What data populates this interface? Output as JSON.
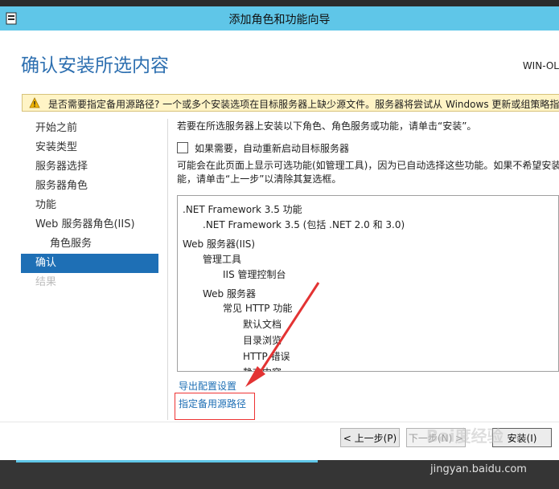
{
  "window": {
    "title": "添加角色和功能向导"
  },
  "header": {
    "page_title": "确认安装所选内容",
    "server_name": "WIN-OL"
  },
  "warning": {
    "text": "是否需要指定备用源路径? 一个或多个安装选项在目标服务器上缺少源文件。服务器将尝试从 Windows 更新或组策略指"
  },
  "nav": {
    "items": [
      {
        "label": "开始之前",
        "state": "normal"
      },
      {
        "label": "安装类型",
        "state": "normal"
      },
      {
        "label": "服务器选择",
        "state": "normal"
      },
      {
        "label": "服务器角色",
        "state": "normal"
      },
      {
        "label": "功能",
        "state": "normal"
      },
      {
        "label": "Web 服务器角色(IIS)",
        "state": "normal"
      },
      {
        "label": "角色服务",
        "state": "sub"
      },
      {
        "label": "确认",
        "state": "active"
      },
      {
        "label": "结果",
        "state": "disabled"
      }
    ]
  },
  "content": {
    "intro": "若要在所选服务器上安装以下角色、角色服务或功能，请单击“安装”。",
    "restart_checkbox_label": "如果需要，自动重新启动目标服务器",
    "note_line1": "可能会在此页面上显示可选功能(如管理工具)，因为已自动选择这些功能。如果不希望安装",
    "note_line2": "能，请单击“上一步”以清除其复选框。",
    "features": [
      ".NET Framework 3.5 功能",
      ".NET Framework 3.5 (包括 .NET 2.0 和 3.0)",
      "Web 服务器(IIS)",
      "管理工具",
      "IIS 管理控制台",
      "Web 服务器",
      "常见 HTTP 功能",
      "默认文档",
      "目录浏览",
      "HTTP 错误",
      "静态内容"
    ],
    "export_link": "导出配置设置",
    "alt_source_link": "指定备用源路径"
  },
  "buttons": {
    "previous": "< 上一步(P)",
    "next": "下一步(N) >",
    "install": "安装(I)"
  },
  "watermark": {
    "site": "jingyan.baidu.com",
    "brand": "Bai度经验"
  },
  "colors": {
    "titlebar": "#5fc6e8",
    "accent_blue": "#1e6fb5",
    "warning_bg": "#fff4c6",
    "annotation_red": "#e33333"
  }
}
